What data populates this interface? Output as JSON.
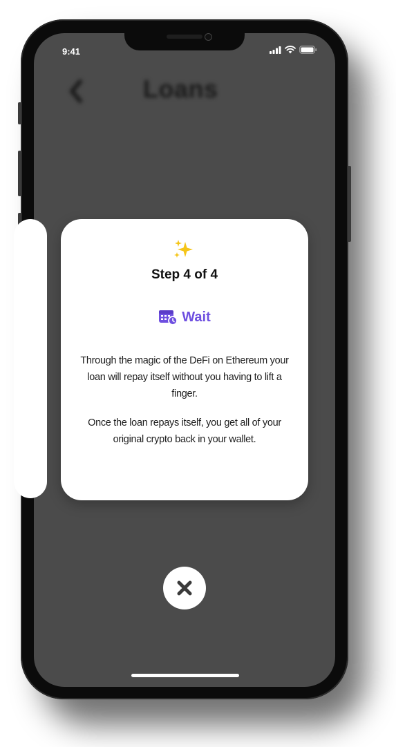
{
  "status_bar": {
    "time": "9:41",
    "signal_icon": "signal-bars-icon",
    "wifi_icon": "wifi-icon",
    "battery_icon": "battery-icon"
  },
  "header": {
    "back_icon": "chevron-left-icon",
    "back_glyph": "‹",
    "title": "Loans"
  },
  "card": {
    "icon": "sparkles-icon",
    "step_label": "Step 4 of 4",
    "action_icon": "calendar-clock-icon",
    "action_label": "Wait",
    "paragraph_1": "Through the magic of the DeFi on Ethereum your loan will repay itself without you having to lift a finger.",
    "paragraph_2": "Once the loan repays itself, you get all of your original crypto back in your wallet."
  },
  "close_button": {
    "icon": "close-icon"
  },
  "colors": {
    "accent": "#6e4fe0",
    "overlay": "#4b4b4b",
    "card": "#ffffff",
    "sparkle": "#f5c518"
  }
}
